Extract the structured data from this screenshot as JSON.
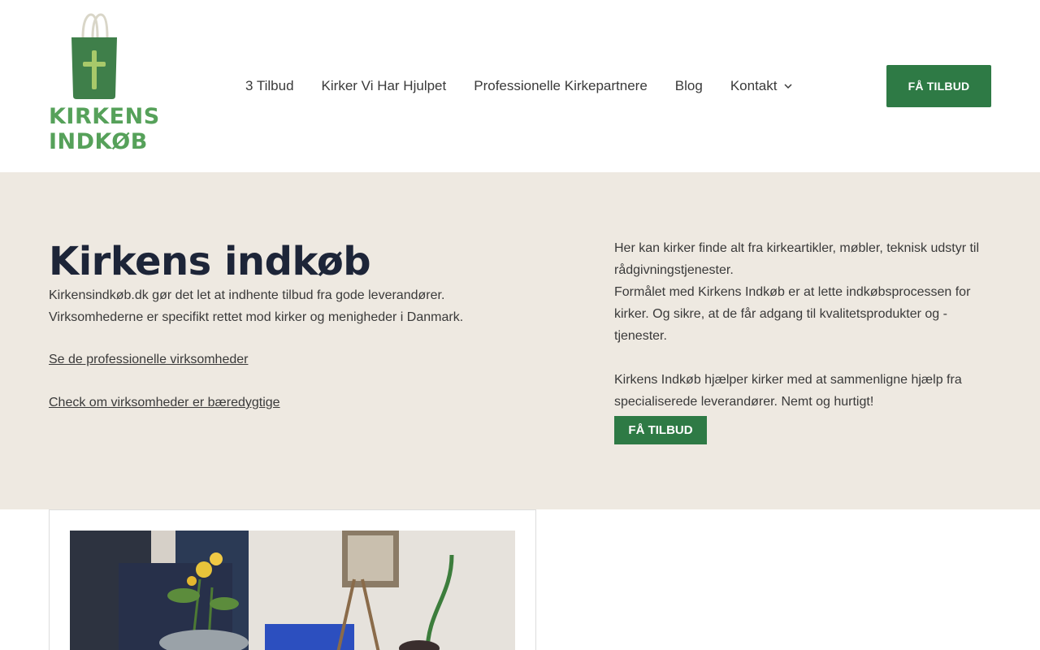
{
  "brand": {
    "line1": "KIRKENS",
    "line2": "INDKØB",
    "color": "#56a15a"
  },
  "nav": {
    "items": [
      {
        "label": "3 Tilbud"
      },
      {
        "label": "Kirker Vi Har Hjulpet"
      },
      {
        "label": "Professionelle Kirkepartnere"
      },
      {
        "label": "Blog"
      },
      {
        "label": "Kontakt",
        "icon": "chevron-down-icon"
      }
    ],
    "cta_label": "FÅ TILBUD"
  },
  "hero": {
    "title": "Kirkens indkøb",
    "lead_line1": "Kirkensindkøb.dk gør det let at indhente tilbud fra gode leverandører.",
    "lead_line2": "Virksomhederne er specifikt rettet mod kirker og menigheder i Danmark.",
    "link1": "Se de professionelle virksomheder",
    "link2": "Check om virksomheder er bæredygtige",
    "right_p1_line1": "Her kan kirker finde alt fra kirkeartikler, møbler, teknisk udstyr til",
    "right_p1_line2": "rådgivningstjenester.",
    "right_p2_line1": "Formålet med Kirkens Indkøb er at lette indkøbsprocessen for",
    "right_p2_line2": "kirker. Og sikre, at de får adgang til kvalitetsprodukter og -tjenester.",
    "right_p3_line1": "Kirkens Indkøb hjælper kirker med at sammenligne hjælp fra",
    "right_p3_line2": "specialiserede leverandører. Nemt og hurtigt!",
    "cta_label": "FÅ TILBUD"
  },
  "colors": {
    "accent": "#2e7a45",
    "hero_bg": "#eee9e1",
    "title": "#1d2538"
  }
}
